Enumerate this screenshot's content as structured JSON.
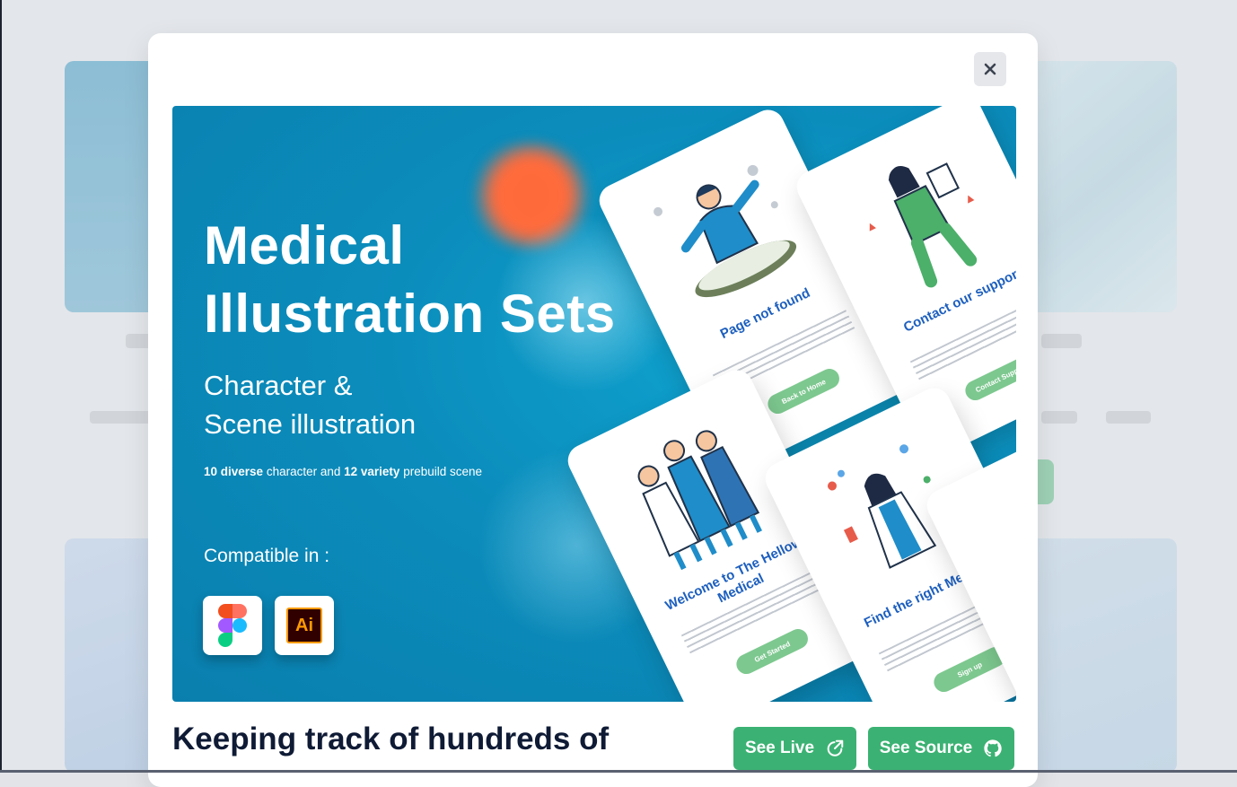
{
  "modal": {
    "close_icon": "close-icon",
    "preview": {
      "title_line1": "Medical",
      "title_line2": "Illustration Sets",
      "subtitle_line1": "Character &",
      "subtitle_line2": "Scene illustration",
      "desc_count1": "10 diverse",
      "desc_text1": " character and ",
      "desc_count2": "12 variety",
      "desc_text2": " prebuild scene",
      "compatible_label": "Compatible in :",
      "apps": [
        {
          "name": "figma-logo-icon"
        },
        {
          "name": "illustrator-logo-icon",
          "label": "Ai"
        }
      ],
      "phones": [
        {
          "title": "Page not found",
          "button": "Back to Home"
        },
        {
          "title": "Contact our support",
          "button": "Contact Support"
        },
        {
          "title": "Welcome to The Hellow Medical",
          "button": "Get Started"
        },
        {
          "title": "Find the right Medicine",
          "button": "Sign up"
        }
      ]
    },
    "headline": "Keeping track of hundreds of",
    "see_live_label": "See Live",
    "see_live_icon": "external-link-icon",
    "see_source_label": "See Source",
    "see_source_icon": "github-icon"
  },
  "colors": {
    "accent_green": "#3bb273",
    "preview_blue": "#0b8dbc",
    "headline": "#0f1b35"
  }
}
